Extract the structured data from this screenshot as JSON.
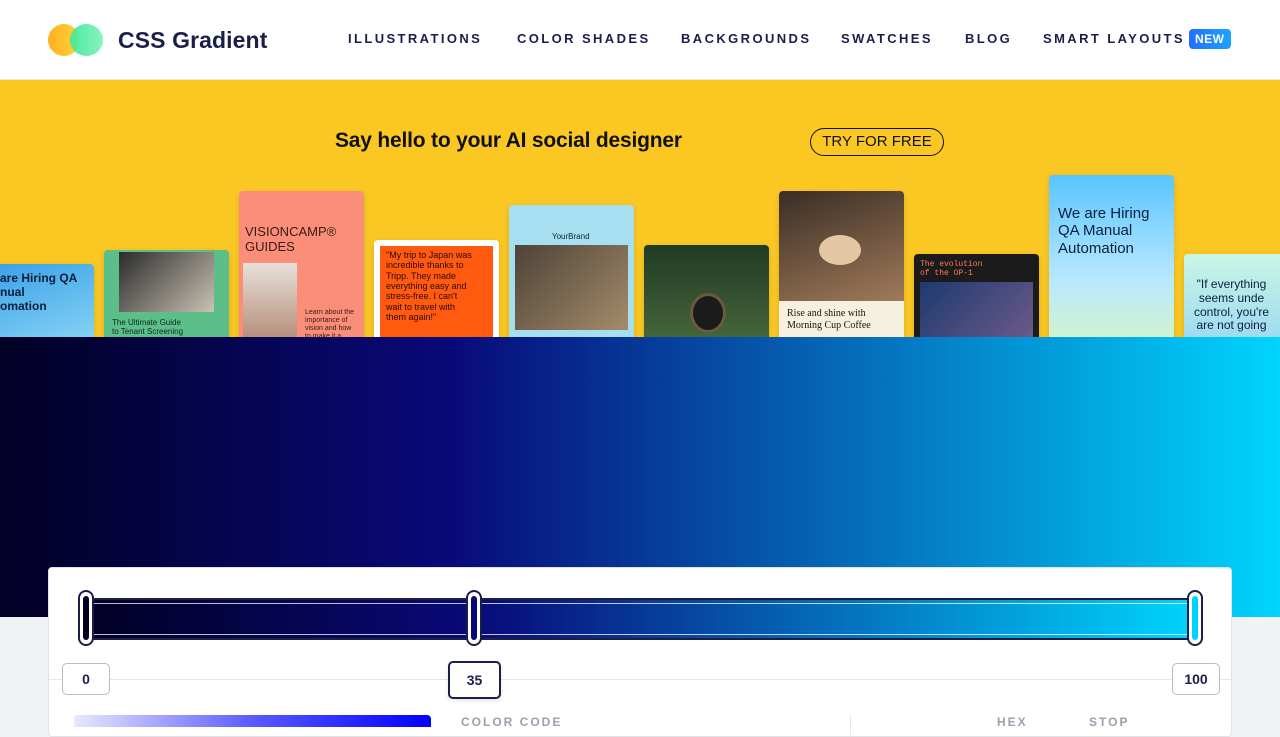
{
  "header": {
    "brand": "CSS Gradient",
    "nav": [
      {
        "label": "ILLUSTRATIONS"
      },
      {
        "label": "COLOR SHADES"
      },
      {
        "label": "BACKGROUNDS"
      },
      {
        "label": "SWATCHES"
      },
      {
        "label": "BLOG"
      },
      {
        "label": "SMART LAYOUTS"
      }
    ],
    "new_badge": "NEW"
  },
  "promo": {
    "title": "Say hello to your AI social designer",
    "cta": "TRY FOR FREE",
    "cards": [
      {
        "text": "are Hiring QA\nnual\nomation"
      },
      {
        "text": "The Ultimate Guide\nto Tenant Screening"
      },
      {
        "text": "VISIONCAMP®\nGUIDES"
      },
      {
        "text": "Learn about the\nimportance of\nvision and how\nto make it a"
      },
      {
        "text": "\"My trip to Japan was\nincredible thanks to\nTripp. They made\neverything easy and\nstress-free. I can't\nwait to travel with\nthem again!\""
      },
      {
        "text": "YourBrand"
      },
      {
        "text": "Rise and shine with\nMorning Cup Coffee"
      },
      {
        "text": "The evolution\nof the OP-1"
      },
      {
        "text": "We are Hiring\nQA Manual\nAutomation"
      },
      {
        "text": "\"If everything\nseems unde\ncontrol, you're\nare not going"
      }
    ]
  },
  "gradient": {
    "colors": {
      "start": "#020024",
      "mid": "#090979",
      "end": "#00d4ff"
    },
    "stops": [
      {
        "position": 0,
        "label": "0"
      },
      {
        "position": 35,
        "label": "35"
      },
      {
        "position": 100,
        "label": "100"
      }
    ],
    "active_stop": 35
  },
  "editor": {
    "color_code_label": "COLOR CODE",
    "hex_label": "HEX",
    "stop_label": "STOP"
  }
}
